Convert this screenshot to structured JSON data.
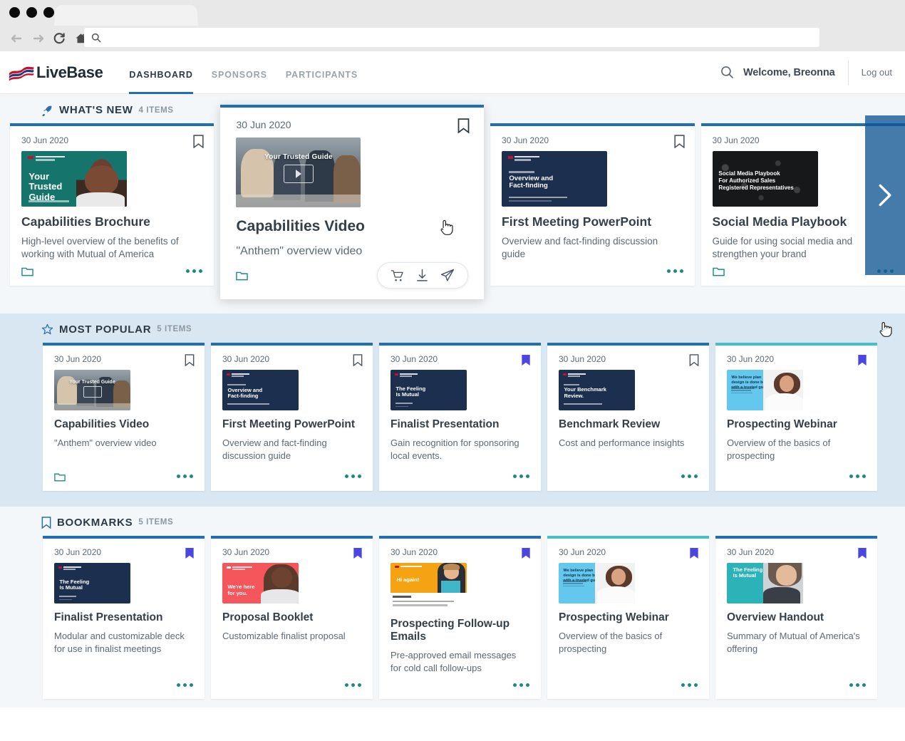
{
  "browser": {
    "controls": [
      "back-arrow",
      "forward-arrow",
      "reload-icon",
      "home-icon"
    ],
    "address_placeholder": "",
    "address_value": ""
  },
  "header": {
    "brand": "LiveBase",
    "tabs": [
      {
        "label": "DASHBOARD",
        "active": true
      },
      {
        "label": "SPONSORS",
        "active": false
      },
      {
        "label": "PARTICIPANTS",
        "active": false
      }
    ],
    "welcome": "Welcome, Breonna",
    "logout": "Log out",
    "accent": "#1f6fb2"
  },
  "sections": [
    {
      "id": "whats-new",
      "icon": "rocket-icon",
      "title": "WHAT'S NEW",
      "count": "4 ITEMS",
      "cards": [
        {
          "date": "30 Jun 2020",
          "title": "Capabilities Brochure",
          "desc": "High-level overview of the benefits of working with Mutual of America",
          "bookmarked": false,
          "thumb": {
            "bg": "#15756d",
            "heading": "Your\nTrusted\nGuide",
            "kind": "person"
          },
          "has_folder": true,
          "has_dots": true,
          "featured": false
        },
        {
          "date": "30 Jun 2020",
          "title": "Capabilities Video",
          "desc": "\"Anthem\" overview video",
          "bookmarked": false,
          "thumb": {
            "bg": "#6f747a",
            "heading": "Your Trusted Guide",
            "kind": "video"
          },
          "has_folder": true,
          "has_dots": false,
          "featured": true,
          "actions": [
            "cart-icon",
            "download-icon",
            "send-icon"
          ]
        },
        {
          "date": "30 Jun 2020",
          "title": "First Meeting PowerPoint",
          "desc": "Overview and fact-finding discussion guide",
          "bookmarked": false,
          "thumb": {
            "bg": "#1d2f4e",
            "heading": "Overview and\nFact-finding",
            "kind": "slide"
          },
          "has_folder": false,
          "has_dots": true,
          "featured": false
        },
        {
          "date": "30 Jun 2020",
          "title": "Social Media Playbook",
          "desc": "Guide for using social media and strengthen your brand",
          "bookmarked": false,
          "thumb": {
            "bg": "#17181a",
            "heading": "Social Media Playbook\nFor Authorized Sales\nRegistered Representatives",
            "kind": "dark"
          },
          "has_folder": true,
          "has_dots": true,
          "featured": false
        }
      ],
      "carousel_next": "chevron-right-icon"
    },
    {
      "id": "most-popular",
      "icon": "star-icon",
      "title": "MOST POPULAR",
      "count": "5 ITEMS",
      "cards": [
        {
          "date": "30 Jun 2020",
          "title": "Capabilities Video",
          "desc": "\"Anthem\" overview video",
          "bookmarked": false,
          "thumb": {
            "bg": "#6f747a",
            "heading": "Your Trusted Guide",
            "kind": "video"
          },
          "has_folder": true,
          "has_dots": true,
          "accent": "#1f6fb2"
        },
        {
          "date": "30 Jun 2020",
          "title": "First Meeting PowerPoint",
          "desc": "Overview and fact-finding discussion guide",
          "bookmarked": false,
          "thumb": {
            "bg": "#1d2f4e",
            "heading": "Overview and\nFact-finding",
            "kind": "slide"
          },
          "has_folder": false,
          "has_dots": true,
          "accent": "#1f6fb2"
        },
        {
          "date": "30 Jun 2020",
          "title": "Finalist Presentation",
          "desc": "Gain recognition for sponsoring local events.",
          "bookmarked": true,
          "thumb": {
            "bg": "#1d2f4e",
            "heading": "The Feeling\nIs Mutual",
            "kind": "slide"
          },
          "has_folder": false,
          "has_dots": true,
          "accent": "#1f6fb2"
        },
        {
          "date": "30 Jun 2020",
          "title": "Benchmark Review",
          "desc": "Cost and performance insights",
          "bookmarked": false,
          "thumb": {
            "bg": "#1d2f4e",
            "heading": "Your Benchmark\nReview.",
            "kind": "slide"
          },
          "has_folder": false,
          "has_dots": true,
          "accent": "#1f6fb2"
        },
        {
          "date": "30 Jun 2020",
          "title": "Prospecting Webinar",
          "desc": "Overview of the basics of prospecting",
          "bookmarked": true,
          "thumb": {
            "bg": "#63c7ee",
            "heading": "We believe plan\ndesign is done best\nwith a trusted guide.",
            "kind": "person-light"
          },
          "has_folder": false,
          "has_dots": true,
          "accent": "#45c0c9"
        }
      ]
    },
    {
      "id": "bookmarks",
      "icon": "bookmark-icon",
      "title": "BOOKMARKS",
      "count": "5 ITEMS",
      "cards": [
        {
          "date": "30 Jun 2020",
          "title": "Finalist Presentation",
          "desc": "Modular and customizable deck for use in finalist meetings",
          "bookmarked": true,
          "thumb": {
            "bg": "#1d2f4e",
            "heading": "The Feeling\nIs Mutual",
            "kind": "slide"
          },
          "has_folder": false,
          "has_dots": true,
          "accent": "#1f6fb2"
        },
        {
          "date": "30 Jun 2020",
          "title": "Proposal Booklet",
          "desc": "Customizable finalist proposal",
          "bookmarked": true,
          "thumb": {
            "bg": "#f4565c",
            "heading": "We're here\nfor you.",
            "kind": "person"
          },
          "has_folder": false,
          "has_dots": true,
          "accent": "#1f6fb2"
        },
        {
          "date": "30 Jun 2020",
          "title": "Prospecting Follow-up Emails",
          "desc": "Pre-approved email messages for cold call follow-ups",
          "bookmarked": true,
          "thumb": {
            "bg": "#f6a313",
            "heading": "Hi again!",
            "kind": "person-doc"
          },
          "has_folder": false,
          "has_dots": true,
          "accent": "#1f6fb2"
        },
        {
          "date": "30 Jun 2020",
          "title": "Prospecting Webinar",
          "desc": "Overview of the basics of prospecting",
          "bookmarked": true,
          "thumb": {
            "bg": "#63c7ee",
            "heading": "We believe plan\ndesign is done best\nwith a trusted guide.",
            "kind": "person-light"
          },
          "has_folder": false,
          "has_dots": true,
          "accent": "#45c0c9"
        },
        {
          "date": "30 Jun 2020",
          "title": "Overview Handout",
          "desc": "Summary of Mutual of America's offering",
          "bookmarked": true,
          "thumb": {
            "bg": "#2bb3b8",
            "heading": "The Feeling\nIs Mutual",
            "kind": "person"
          },
          "has_folder": false,
          "has_dots": true,
          "accent": "#1f6fb2"
        }
      ]
    }
  ],
  "colors": {
    "accent_blue": "#1f6fb2",
    "accent_teal": "#45c0c9",
    "bookmark_filled": "#4a47e0",
    "teal_icon": "#1b8a86",
    "section_bg_light": "#f3f7fa",
    "section_bg_blue": "#d9e7f2"
  }
}
